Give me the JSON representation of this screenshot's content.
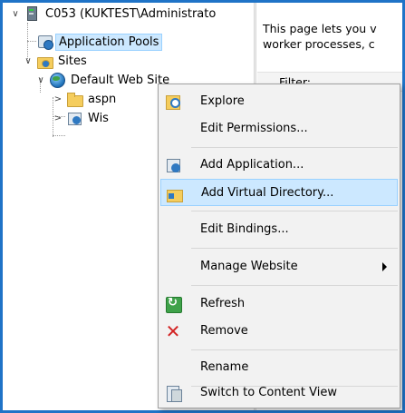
{
  "tree": {
    "server_label": "C053 (KUKTEST\\Administrato",
    "app_pools_label": "Application Pools",
    "sites_label": "Sites",
    "default_site_label": "Default Web Site",
    "child1_label": "aspn",
    "child2_label": "Wis",
    "toggle_expanded": "∨",
    "toggle_collapsed": ">"
  },
  "right_pane": {
    "description_line1": "This page lets you v",
    "description_line2": "worker processes, c",
    "filter_label": "Filter:"
  },
  "context_menu": {
    "items": [
      {
        "label": "Explore",
        "icon": "explore-icon"
      },
      {
        "label": "Edit Permissions...",
        "icon": ""
      },
      {
        "label": "Add Application...",
        "icon": "add-application-icon"
      },
      {
        "label": "Add Virtual Directory...",
        "icon": "add-virtual-directory-icon"
      },
      {
        "label": "Edit Bindings...",
        "icon": ""
      },
      {
        "label": "Manage Website",
        "icon": "",
        "has_submenu": true
      },
      {
        "label": "Refresh",
        "icon": "refresh-icon"
      },
      {
        "label": "Remove",
        "icon": "remove-icon"
      },
      {
        "label": "Rename",
        "icon": ""
      },
      {
        "label": "Switch to Content View",
        "icon": "content-view-icon"
      }
    ],
    "highlighted_item": "Add Virtual Directory...",
    "remove_glyph": "✕"
  },
  "colors": {
    "window_border": "#1f73c7",
    "selection_bg": "#cce8ff",
    "selection_border": "#99d1ff",
    "menu_bg": "#f2f2f2",
    "remove_red": "#d32424"
  }
}
